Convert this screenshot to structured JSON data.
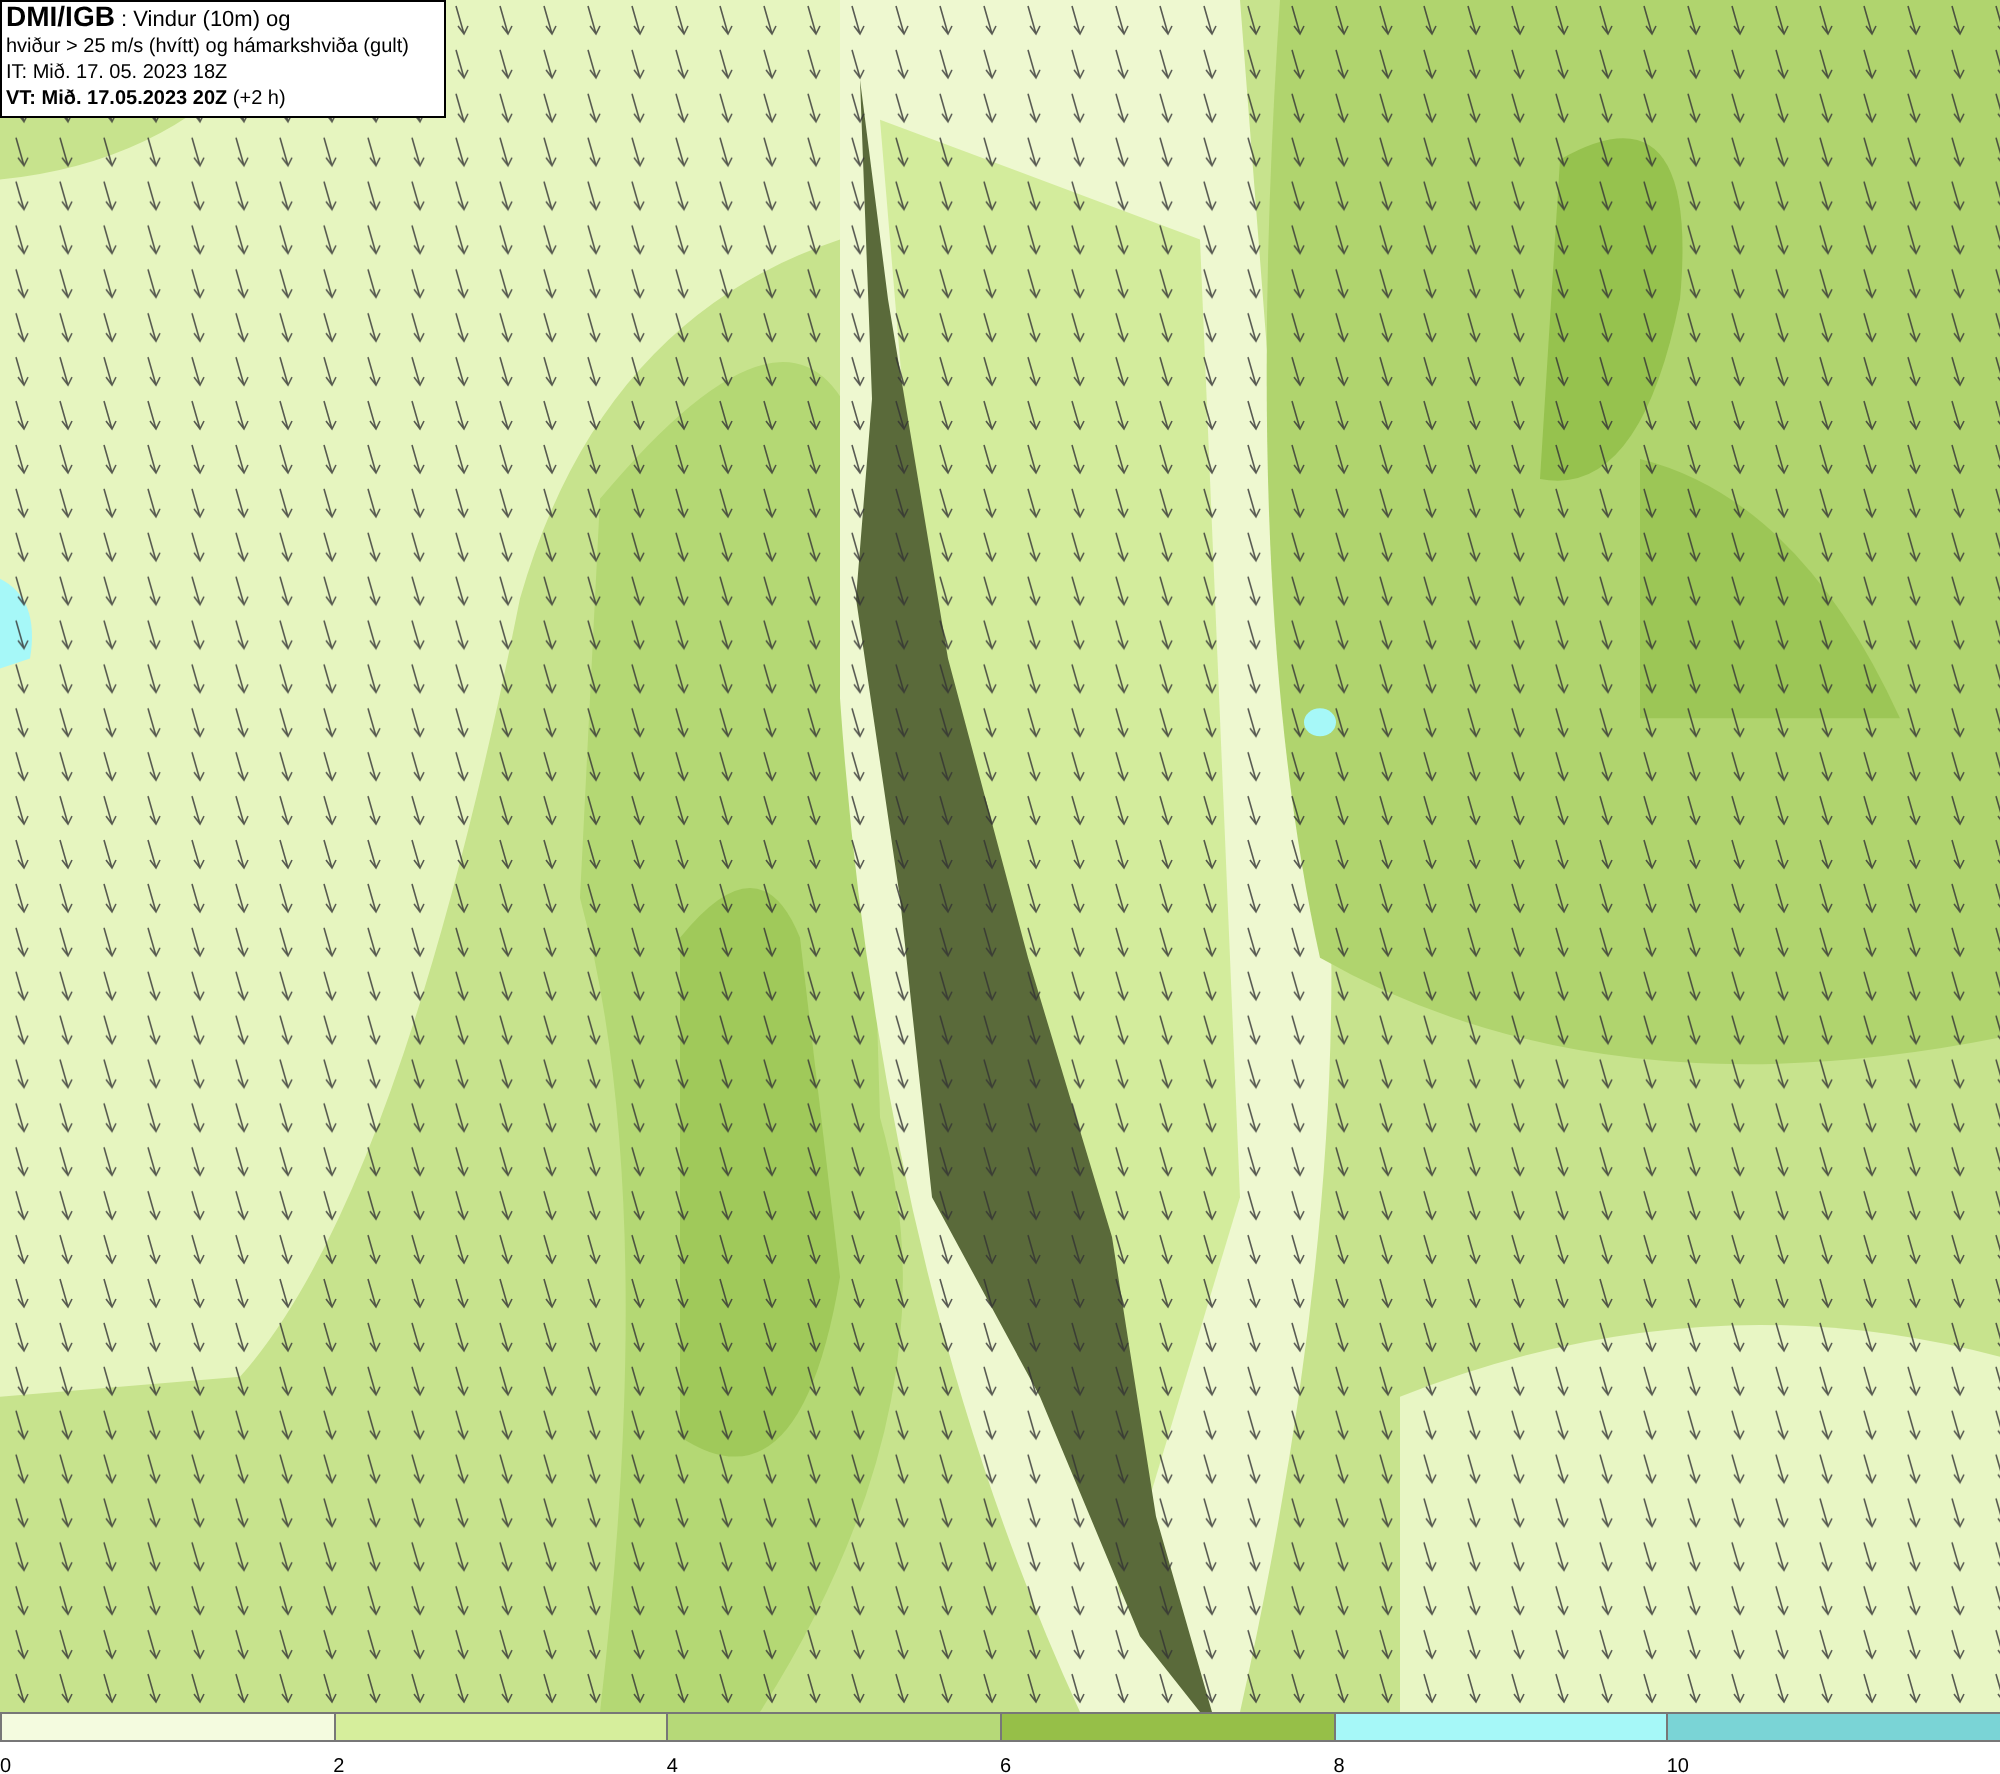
{
  "map": {
    "title_lines": [
      "**DMI/IGB** : Vindur (10m) og",
      "hviður > 25 m/s (hvítt) og hámarkshviða (gult)",
      "IT: Mið. 17. 05. 2023 18Z",
      "**VT: Mið. 17.05.2023 20Z** (+2 h)"
    ]
  },
  "colorbar": {
    "bins": [
      {
        "color": "#f4fbdf"
      },
      {
        "color": "#d6ee9c"
      },
      {
        "color": "#b6d978"
      },
      {
        "color": "#96bf48"
      },
      {
        "color": "#a6f8f8"
      },
      {
        "color": "#7ad4d6"
      }
    ],
    "ticks": [
      "0",
      "2",
      "4",
      "6",
      "8",
      "10"
    ]
  }
}
